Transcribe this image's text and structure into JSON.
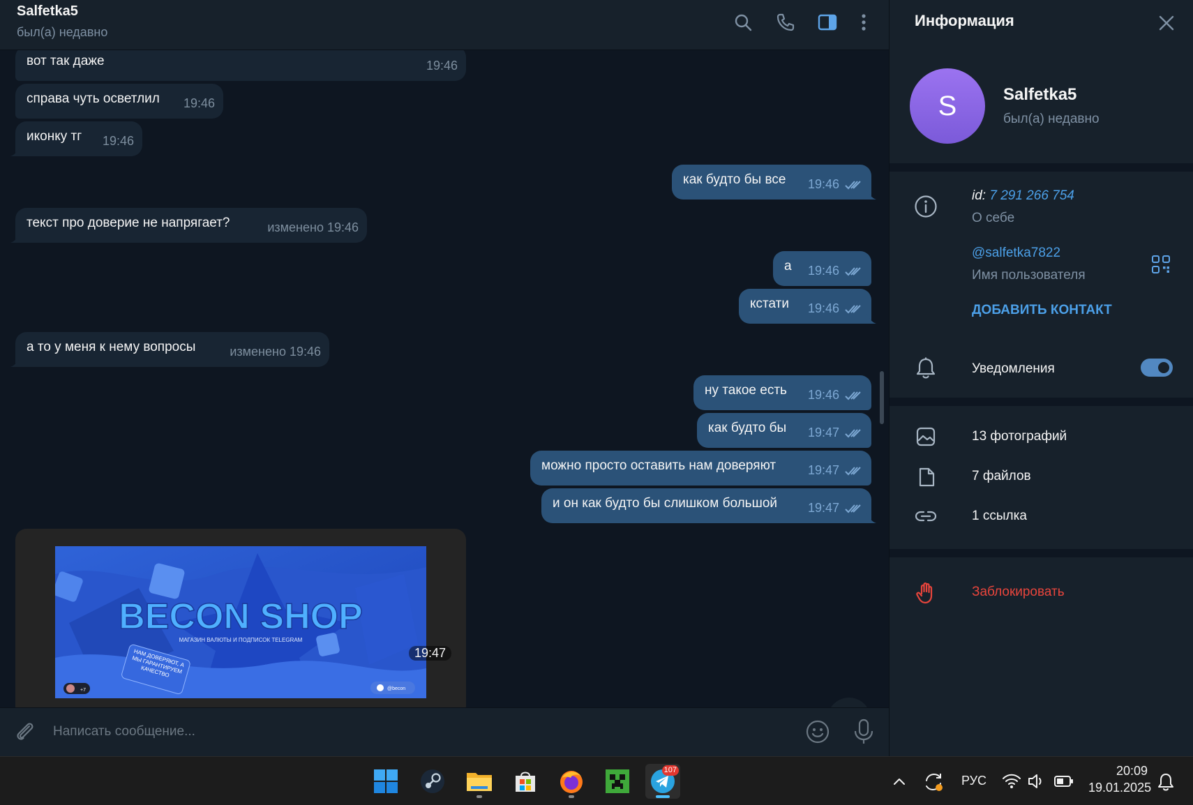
{
  "header": {
    "name": "Salfetka5",
    "status": "был(а) недавно"
  },
  "messages": [
    {
      "side": "in",
      "text": "вот так даже",
      "meta": "19:46"
    },
    {
      "side": "in",
      "text": "справа чуть осветлил",
      "meta": "19:46"
    },
    {
      "side": "in",
      "text": "иконку тг",
      "meta": "19:46"
    },
    {
      "side": "out",
      "text": "как будто бы все",
      "meta": "19:46"
    },
    {
      "side": "in",
      "text": "текст про доверие не напрягает?",
      "meta": "изменено 19:46"
    },
    {
      "side": "out",
      "text": "а",
      "meta": "19:46"
    },
    {
      "side": "out",
      "text": "кстати",
      "meta": "19:46"
    },
    {
      "side": "in",
      "text": "а то у меня к нему вопросы",
      "meta": "изменено 19:46"
    },
    {
      "side": "out",
      "text": "ну такое есть",
      "meta": "19:46"
    },
    {
      "side": "out",
      "text": "как будто бы",
      "meta": "19:47"
    },
    {
      "side": "out",
      "text": "можно просто оставить нам доверяют",
      "meta": "19:47"
    },
    {
      "side": "out",
      "text": "и он как будто бы слишком большой",
      "meta": "19:47"
    }
  ],
  "image_message": {
    "title": "BECON SHOP",
    "subtitle": "МАГАЗИН ВАЛЮТЫ И ПОДПИСОК TELEGRAM",
    "card_text": "НАМ ДОВЕРЯЮТ, А МЫ ГАРАНТИРУЕМ КАЧЕСТВО",
    "plus": "+7",
    "handle": "@becon",
    "time": "19:47"
  },
  "composer": {
    "placeholder": "Написать сообщение..."
  },
  "info_panel": {
    "title": "Информация",
    "avatar_letter": "S",
    "name": "Salfetka5",
    "status": "был(а) недавно",
    "id_label": "id:",
    "id_value": "7 291 266 754",
    "about_label": "О себе",
    "username": "@salfetka7822",
    "username_label": "Имя пользователя",
    "add_contact": "ДОБАВИТЬ КОНТАКТ",
    "notifications": "Уведомления",
    "notifications_on": true,
    "photos": "13 фотографий",
    "files": "7 файлов",
    "links": "1 ссылка",
    "block": "Заблокировать"
  },
  "taskbar": {
    "telegram_badge": "107",
    "language": "РУС",
    "time": "20:09",
    "date": "19.01.2025"
  },
  "colors": {
    "outgoing_bubble": "#2b5278",
    "incoming_bubble": "#182533",
    "accent": "#5288c1",
    "link": "#4ca0e8",
    "danger": "#e8453c"
  }
}
